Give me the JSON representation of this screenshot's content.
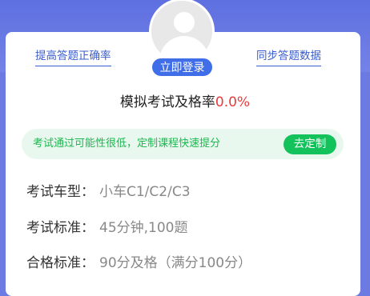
{
  "links": {
    "left": "提高答题正确率",
    "right": "同步答题数据"
  },
  "login": {
    "label": "立即登录"
  },
  "pass": {
    "label": "模拟考试及格率",
    "rate": "0.0%"
  },
  "banner": {
    "text": "考试通过可能性很低，定制课程快速提分",
    "button": "去定制"
  },
  "info": [
    {
      "label": "考试车型：",
      "value": "小车C1/C2/C3"
    },
    {
      "label": "考试标准：",
      "value": "45分钟,100题"
    },
    {
      "label": "合格标准：",
      "value": "90分及格（满分100分）"
    }
  ],
  "colors": {
    "header_bg": "#6b7be2",
    "link": "#3a5ccc",
    "login_button": "#3f6ee8",
    "rate": "#e83b3b",
    "banner_bg": "#e9f8ee",
    "banner_text": "#19b84f",
    "banner_button": "#13c25a"
  },
  "icons": {
    "avatar": "default-user-avatar-icon"
  }
}
